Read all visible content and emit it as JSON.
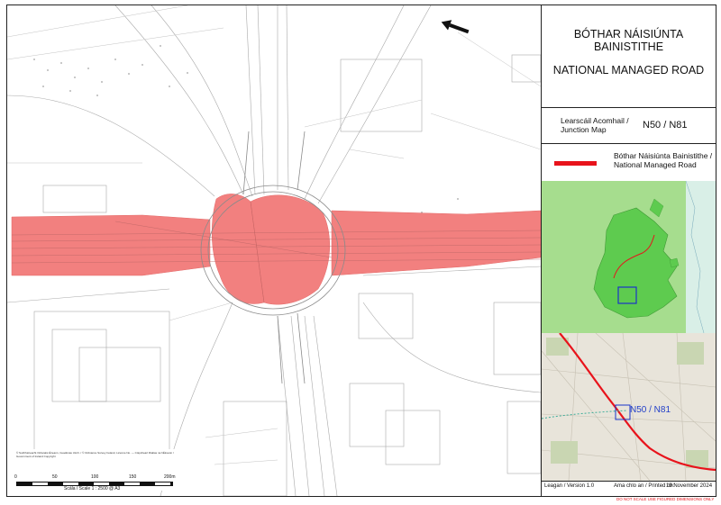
{
  "panel": {
    "title_irish": "BÓTHAR NÁISIÚNTA BAINISTITHE",
    "title_english": "NATIONAL MANAGED ROAD",
    "junction_map_label": "Learscáil Acomhail / Junction Map",
    "junction_code": "N50 / N81",
    "legend_label": "Bóthar Náisiúnta Bainistithe / National Managed Road",
    "ortho_label": "N50 / N81",
    "version": "Leagan / Version 1.0",
    "printed_label": "Ama chlo an / Printed on:",
    "printed_date": "19 November 2024",
    "warning": "DO NOT SCALE USE FIGURED DIMENSIONS ONLY"
  },
  "scale": {
    "ticks": [
      "0",
      "50",
      "100",
      "150",
      "200m"
    ],
    "scale_text": "Scála / Scale 1 : 2500 @ A3",
    "copyright_note": "© Suirbhéireacht Ordanáis Éireann, Ceadúnas Uimh. / © Ordnance Survey Ireland, Licence No. — Cóipcheart Rialtas na hÉireann / Government of Ireland Copyright"
  },
  "colors": {
    "managed_road": "#e8131b",
    "managed_area_fill": "#f2807f",
    "locator_green": "#5ecb4f",
    "locator_bg": "#a6dd8e",
    "frame": "#222222"
  }
}
